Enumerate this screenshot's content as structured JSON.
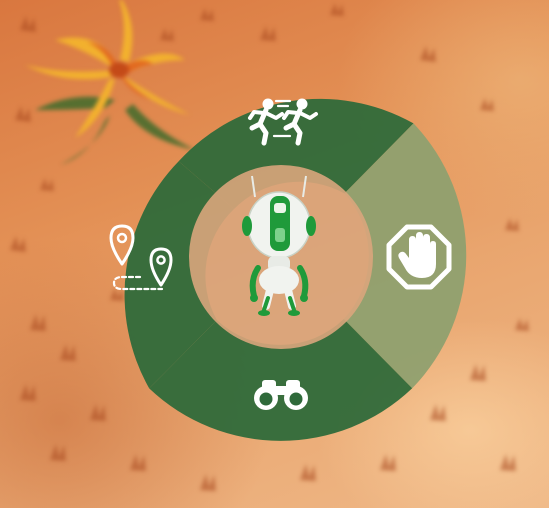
{
  "radial_menu": {
    "segments": [
      {
        "id": "follow",
        "icon": "follow-me-runners-icon",
        "state": "normal"
      },
      {
        "id": "stop",
        "icon": "stop-hand-octagon-icon",
        "state": "highlighted"
      },
      {
        "id": "scout",
        "icon": "binoculars-icon",
        "state": "normal"
      },
      {
        "id": "move-to",
        "icon": "waypoint-path-icon",
        "state": "normal"
      }
    ],
    "center": {
      "icon": "robot-avatar"
    }
  },
  "colors": {
    "segment_fill": "#2f6a3a",
    "segment_highlight": "#8fa06f",
    "center_fill": "#d9a57c",
    "robot_green": "#1f9a3a",
    "robot_white": "#f1f3ef",
    "icon_white": "#ffffff",
    "desert_sand": "#e39055",
    "flower_yellow": "#f2b12e"
  }
}
